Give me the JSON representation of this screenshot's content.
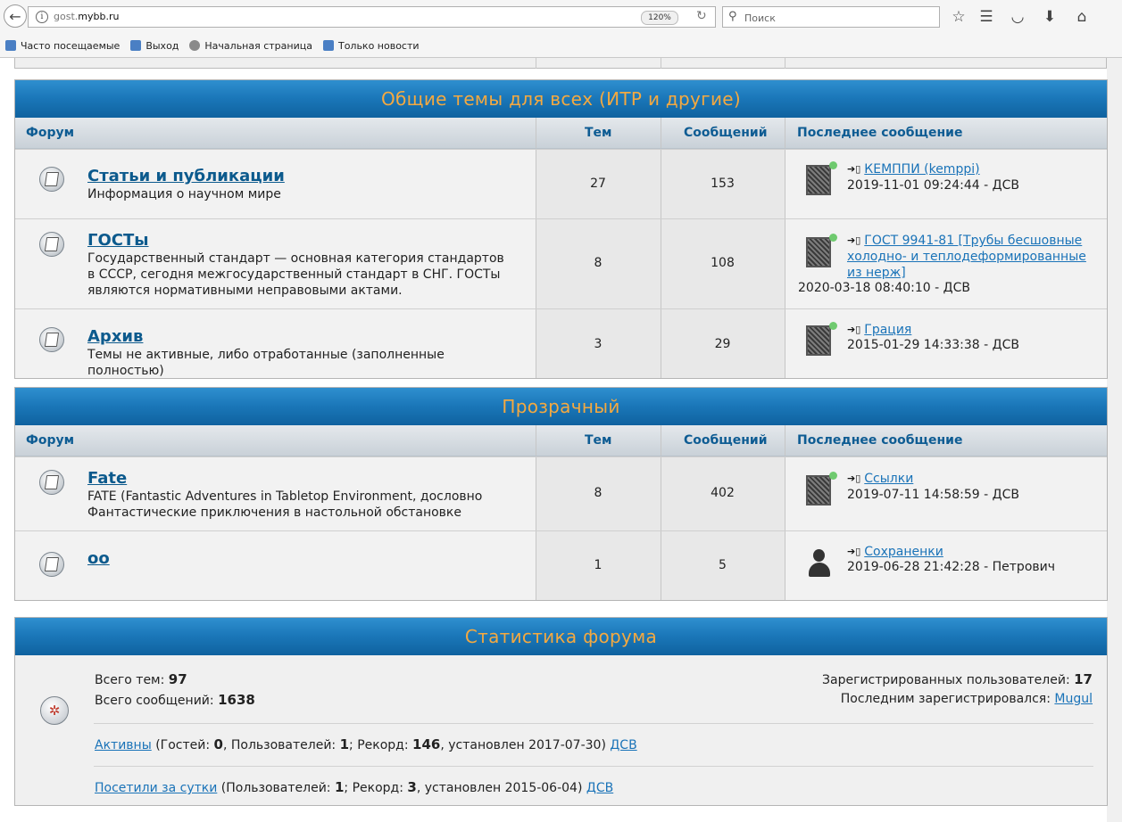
{
  "browser": {
    "url_prefix": "gost.",
    "url_host": "mybb.ru",
    "zoom": "120%",
    "search_placeholder": "Поиск",
    "bookmarks": [
      {
        "label": "Часто посещаемые"
      },
      {
        "label": "Выход"
      },
      {
        "label": "Начальная страница"
      },
      {
        "label": "Только новости"
      }
    ]
  },
  "categories": [
    {
      "title": "Общие темы для всех (ИТР и другие)",
      "headers": {
        "forum": "Форум",
        "topics": "Тем",
        "posts": "Сообщений",
        "last": "Последнее сообщение"
      },
      "forums": [
        {
          "title": "Статьи и публикации",
          "desc": "Информация о научном мире",
          "topics": "27",
          "posts": "153",
          "last_link": "КЕМППИ (kemppi)",
          "last_meta": "2019-11-01 09:24:44 - ДСВ"
        },
        {
          "title": "ГОСТы",
          "desc": "Государственный стандарт — основная категория стандартов в СССР, сегодня межгосударственный стандарт в СНГ. ГОСТы являются нормативными неправовыми актами.",
          "topics": "8",
          "posts": "108",
          "last_link": "ГОСТ 9941-81 [Трубы бесшовные холодно- и теплодеформированные из нерж]",
          "last_meta": "2020-03-18 08:40:10 - ДСВ"
        },
        {
          "title": "Архив",
          "desc": "Темы не активные, либо отработанные (заполненные полностью)",
          "topics": "3",
          "posts": "29",
          "last_link": "Грация",
          "last_meta": "2015-01-29 14:33:38 - ДСВ"
        }
      ]
    },
    {
      "title": "Прозрачный",
      "headers": {
        "forum": "Форум",
        "topics": "Тем",
        "posts": "Сообщений",
        "last": "Последнее сообщение"
      },
      "forums": [
        {
          "title": "Fate",
          "desc": "FATE (Fantastic Adventures in Tabletop Environment, дословно Фантастические приключения в настольной обстановке",
          "topics": "8",
          "posts": "402",
          "last_link": "Ссылки",
          "last_meta": "2019-07-11 14:58:59 - ДСВ"
        },
        {
          "title": "oo",
          "desc": "",
          "topics": "1",
          "posts": "5",
          "last_link": "Сохраненки",
          "last_meta": "2019-06-28 21:42:28 - Петрович"
        }
      ]
    }
  ],
  "stats": {
    "title": "Статистика форума",
    "total_topics_label": "Всего тем:",
    "total_topics": "97",
    "total_posts_label": "Всего сообщений:",
    "total_posts": "1638",
    "registered_label": "Зарегистрированных пользователей:",
    "registered": "17",
    "last_registered_label": "Последним зарегистрировался:",
    "last_registered": "Mugul",
    "active_link": "Активны",
    "active_guests_label": "(Гостей:",
    "active_guests": "0",
    "active_users_label": ", Пользователей:",
    "active_users": "1",
    "active_record_label": "; Рекорд:",
    "active_record": "146",
    "active_date": ", установлен 2017-07-30)",
    "active_user": "ДСВ",
    "visited_link": "Посетили за сутки",
    "visited_users_label": "(Пользователей:",
    "visited_users": "1",
    "visited_record_label": "; Рекорд:",
    "visited_record": "3",
    "visited_date": ", установлен 2015-06-04)",
    "visited_user": "ДСВ"
  }
}
